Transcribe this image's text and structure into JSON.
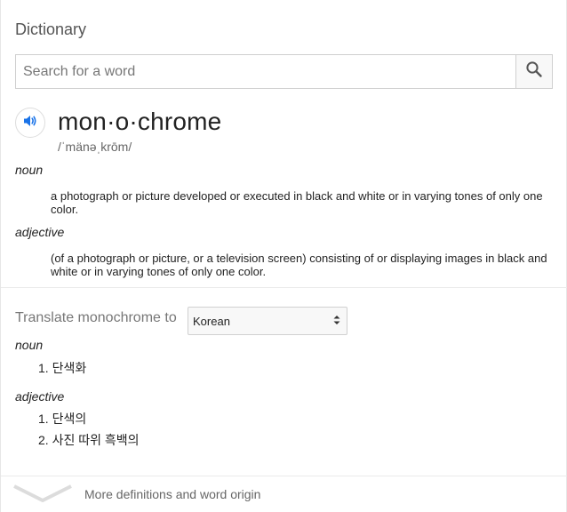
{
  "header": {
    "title": "Dictionary"
  },
  "search": {
    "placeholder": "Search for a word",
    "value": ""
  },
  "entry": {
    "word": "mon·o·chrome",
    "phonetic": "/ˈmänəˌkrōm/",
    "senses": [
      {
        "pos": "noun",
        "definition": "a photograph or picture developed or executed in black and white or in varying tones of only one color."
      },
      {
        "pos": "adjective",
        "definition": "(of a photograph or picture, or a television screen) consisting of or displaying images in black and white or in varying tones of only one color."
      }
    ]
  },
  "translate": {
    "label": "Translate monochrome to",
    "language": "Korean",
    "groups": [
      {
        "pos": "noun",
        "items": [
          "1. 단색화"
        ]
      },
      {
        "pos": "adjective",
        "items": [
          "1. 단색의",
          "2. 사진 따위 흑백의"
        ]
      }
    ]
  },
  "footer": {
    "more_label": "More definitions and word origin"
  },
  "colors": {
    "accent": "#1a73e8",
    "muted_text": "#777777",
    "divider": "#ebebeb"
  },
  "icons": [
    "search-icon",
    "speaker-icon",
    "select-arrows-icon",
    "chevron-down-icon"
  ]
}
